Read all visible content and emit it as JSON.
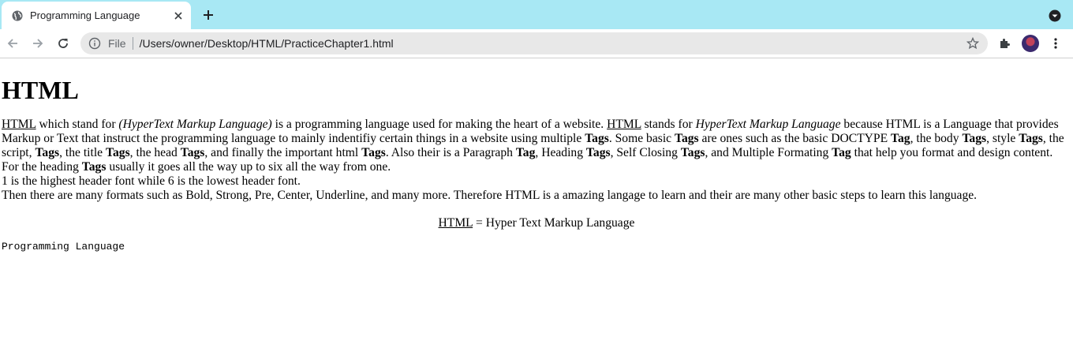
{
  "browser": {
    "tab": {
      "title": "Programming Language"
    },
    "omnibox": {
      "scheme": "File",
      "url": "/Users/owner/Desktop/HTML/PracticeChapter1.html"
    },
    "colors": {
      "tabstrip": "#a8e8f4",
      "omnibox": "#e8e8e8"
    },
    "icons": {
      "tab_favicon": "globe-icon",
      "tab_close": "close-icon",
      "new_tab": "plus-icon",
      "tab_search": "chevron-down-icon",
      "back": "arrow-left-icon",
      "forward": "arrow-right-icon",
      "reload": "reload-icon",
      "site_info": "info-icon",
      "bookmark": "star-icon",
      "extensions": "puzzle-icon",
      "menu": "kebab-icon"
    }
  },
  "page": {
    "heading": "HTML",
    "p": {
      "s1": "HTML",
      "s2": " which stand for ",
      "s3": "(HyperText Markup Language)",
      "s4": " is a programming language used for making the heart of a website. ",
      "s5": "HTML",
      "s6": " stands for ",
      "s7": "HyperText Markup Language",
      "s8": " because HTML is a Language that provides Markup or Text that instruct the programming language to mainly indentifiy certain things in a website using multiple ",
      "s9": "Tags",
      "s10": ". Some basic ",
      "s11": "Tags",
      "s12": " are ones such as the basic DOCTYPE ",
      "s13": "Tag",
      "s14": ", the body ",
      "s15": "Tags",
      "s16": ", style ",
      "s17": "Tags",
      "s18": ", the script, ",
      "s19": "Tags",
      "s20": ", the title ",
      "s21": "Tags",
      "s22": ", the head ",
      "s23": "Tags",
      "s24": ", and finally the important html ",
      "s25": "Tags",
      "s26": ". Also their is a Paragraph ",
      "s27": "Tag",
      "s28": ", Heading ",
      "s29": "Tags",
      "s30": ", Self Closing ",
      "s31": "Tags",
      "s32": ", and Multiple Formating ",
      "s33": "Tag",
      "s34": " that help you format and design content. For the heading ",
      "s35": "Tags",
      "s36": " usually it goes all the way up to six all the way from one.",
      "line2": "1 is the highest header font while 6 is the lowest header font.",
      "line3": "Then there are many formats such as Bold, Strong, Pre, Center, Underline, and many more. Therefore HTML is a amazing langage to learn and their are many other basic steps to learn this language."
    },
    "center": {
      "abbr": "HTML",
      "rest": " = Hyper Text Markup Language"
    },
    "pre": "Programming Language"
  }
}
